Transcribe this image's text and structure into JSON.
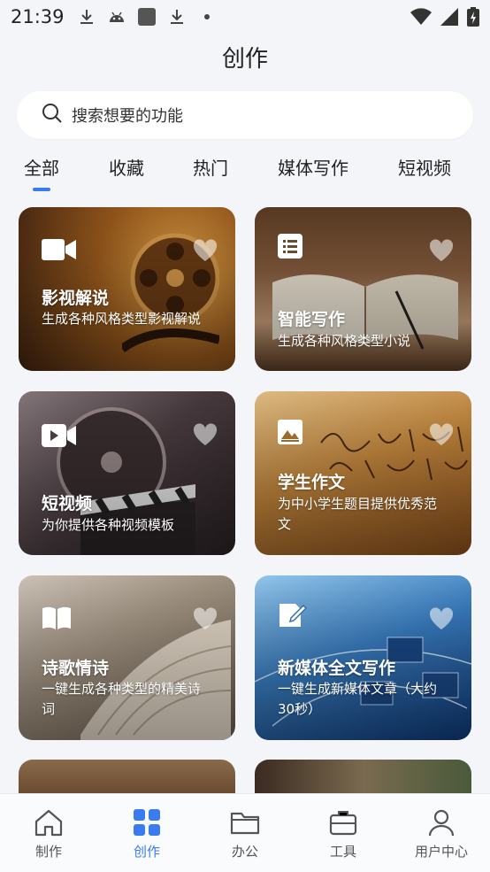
{
  "status_bar": {
    "time": "21:39",
    "icons_left": [
      "download-icon",
      "android-icon",
      "app-icon",
      "download-icon",
      "dot-icon"
    ],
    "icons_right": [
      "wifi-icon",
      "signal-icon",
      "battery-charging-icon"
    ]
  },
  "header": {
    "title": "创作"
  },
  "search": {
    "placeholder": "搜索想要的功能"
  },
  "tabs": [
    {
      "label": "全部",
      "active": true
    },
    {
      "label": "收藏",
      "active": false
    },
    {
      "label": "热门",
      "active": false
    },
    {
      "label": "媒体写作",
      "active": false
    },
    {
      "label": "短视频",
      "active": false
    }
  ],
  "cards": [
    {
      "title": "影视解说",
      "desc": "生成各种风格类型影视解说",
      "icon": "video-camera-icon",
      "theme": "#8a4a12"
    },
    {
      "title": "智能写作",
      "desc": "生成各种风格类型小说",
      "icon": "list-icon",
      "theme": "#6b4a2e"
    },
    {
      "title": "短视频",
      "desc": "为你提供各种视频模板",
      "icon": "video-icon",
      "theme": "#3e3438"
    },
    {
      "title": "学生作文",
      "desc": "为中小学生题目提供优秀范文",
      "icon": "image-icon",
      "theme": "#b2782e"
    },
    {
      "title": "诗歌情诗",
      "desc": "一键生成各种类型的精美诗词",
      "icon": "book-icon",
      "theme": "#8a7a68"
    },
    {
      "title": "新媒体全文写作",
      "desc": "一键生成新媒体文章（大约30秒）",
      "icon": "edit-icon",
      "theme": "#2e6fb5"
    }
  ],
  "bottom_nav": [
    {
      "label": "制作",
      "icon": "home-icon",
      "active": false
    },
    {
      "label": "创作",
      "icon": "grid-icon",
      "active": true
    },
    {
      "label": "办公",
      "icon": "folder-icon",
      "active": false
    },
    {
      "label": "工具",
      "icon": "briefcase-icon",
      "active": false
    },
    {
      "label": "用户中心",
      "icon": "user-icon",
      "active": false
    }
  ],
  "colors": {
    "accent": "#3a7cf0",
    "background": "#f3f5f8"
  }
}
